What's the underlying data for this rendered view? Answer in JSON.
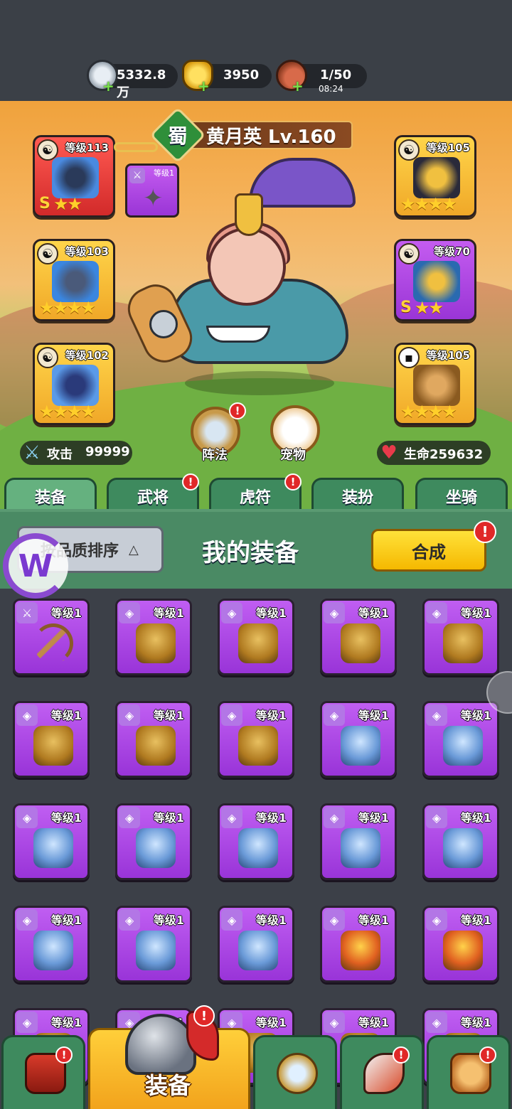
{
  "currency": {
    "silver": {
      "icon": "silver-coin-icon",
      "value": "5332.8万"
    },
    "gold": {
      "icon": "gold-ingot-icon",
      "value": "3950"
    },
    "stamina": {
      "icon": "meat-icon",
      "value": "1/50",
      "timer": "08:24"
    }
  },
  "hero": {
    "faction": "蜀",
    "name": "黄月英 Lv.160",
    "slots": [
      {
        "level": "等级113",
        "grade": "S",
        "stars": "★★"
      },
      {
        "level": "等级103",
        "stars": "★★★★"
      },
      {
        "level": "等级102",
        "stars": "★★★★"
      },
      {
        "level": "等级105",
        "stars": "★★★★"
      },
      {
        "level": "等级70",
        "grade": "S",
        "stars": "★★"
      },
      {
        "level": "等级105",
        "stars": "★★★★"
      }
    ],
    "mini_slot_level": "等级1",
    "formation_label": "阵法",
    "pet_label": "宠物",
    "attack_label": "攻击",
    "attack_value": "99999",
    "hp_label": "生命259632"
  },
  "tabs": [
    "装备",
    "武将",
    "虎符",
    "装扮",
    "坐骑"
  ],
  "panel": {
    "sort_label": "按品质排序",
    "title": "我的装备",
    "merge_label": "合成"
  },
  "items": [
    {
      "type": "weapon",
      "level": "等级1",
      "art": "bow"
    },
    {
      "type": "armor",
      "level": "等级1",
      "art": "armor-gold"
    },
    {
      "type": "armor",
      "level": "等级1",
      "art": "armor-gold"
    },
    {
      "type": "armor",
      "level": "等级1",
      "art": "armor-gold"
    },
    {
      "type": "armor",
      "level": "等级1",
      "art": "armor-gold"
    },
    {
      "type": "armor",
      "level": "等级1",
      "art": "armor-gold"
    },
    {
      "type": "armor",
      "level": "等级1",
      "art": "armor-gold"
    },
    {
      "type": "armor",
      "level": "等级1",
      "art": "armor-gold"
    },
    {
      "type": "armor",
      "level": "等级1",
      "art": "armor-blue"
    },
    {
      "type": "armor",
      "level": "等级1",
      "art": "armor-blue"
    },
    {
      "type": "armor",
      "level": "等级1",
      "art": "armor-blue"
    },
    {
      "type": "armor",
      "level": "等级1",
      "art": "armor-blue"
    },
    {
      "type": "armor",
      "level": "等级1",
      "art": "armor-blue"
    },
    {
      "type": "armor",
      "level": "等级1",
      "art": "armor-blue"
    },
    {
      "type": "armor",
      "level": "等级1",
      "art": "armor-blue"
    },
    {
      "type": "armor",
      "level": "等级1",
      "art": "armor-blue"
    },
    {
      "type": "armor",
      "level": "等级1",
      "art": "armor-blue"
    },
    {
      "type": "armor",
      "level": "等级1",
      "art": "armor-blue"
    },
    {
      "type": "armor",
      "level": "等级1",
      "art": "armor-red"
    },
    {
      "type": "armor",
      "level": "等级1",
      "art": "armor-red"
    },
    {
      "type": "armor",
      "level": "等级1",
      "art": "armor-gold"
    },
    {
      "type": "armor",
      "level": "等级1",
      "art": "armor-gold"
    },
    {
      "type": "armor",
      "level": "等级1",
      "art": "armor-gold"
    },
    {
      "type": "armor",
      "level": "等级1",
      "art": "armor-gold"
    },
    {
      "type": "armor",
      "level": "等级1",
      "art": "armor-gold"
    }
  ],
  "nav": {
    "active_label": "装备",
    "icons": [
      "gate-icon",
      "helmet-icon",
      "crossed-swords-icon",
      "horn-icon",
      "fist-upgrade-icon"
    ]
  },
  "badge": "!"
}
